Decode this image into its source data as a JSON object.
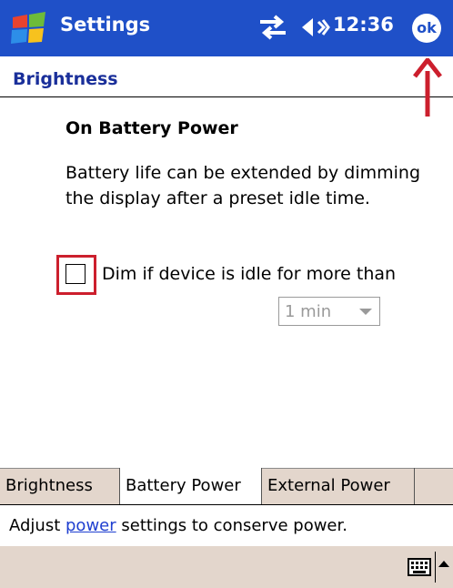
{
  "titlebar": {
    "app_title": "Settings",
    "time": "12:36",
    "ok_label": "ok"
  },
  "page": {
    "title": "Brightness",
    "section_heading": "On Battery Power",
    "description": "Battery life can be extended by dimming the display after a preset idle time.",
    "dim_label": "Dim if device is idle for more than",
    "dim_checked": false,
    "idle_select_value": "1 min"
  },
  "tabs": [
    {
      "label": "Brightness",
      "active": false
    },
    {
      "label": "Battery Power",
      "active": true
    },
    {
      "label": "External Power",
      "active": false
    }
  ],
  "help": {
    "prefix": "Adjust ",
    "link": "power",
    "suffix": " settings to conserve power."
  },
  "annotation_color": "#cc1f2d",
  "titlebar_color": "#1f50c8",
  "toolbar_color": "#e3d6cc"
}
